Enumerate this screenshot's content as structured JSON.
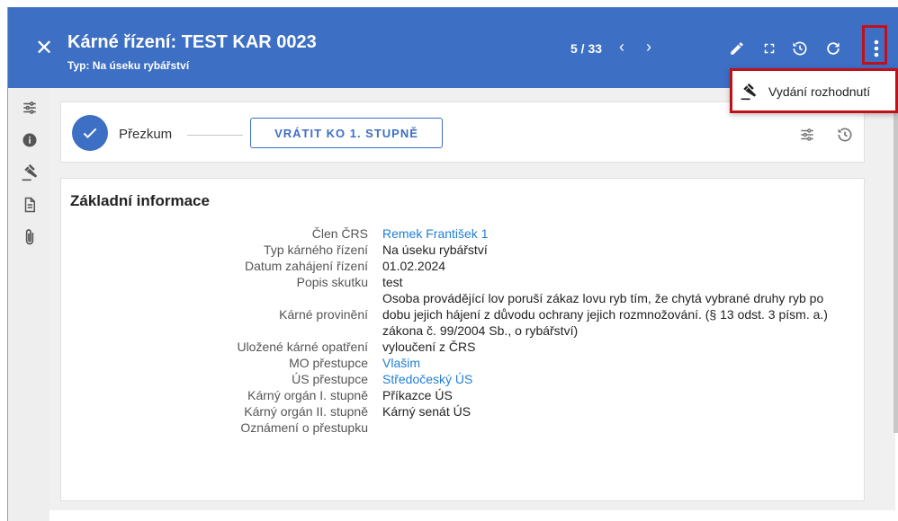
{
  "header": {
    "title": "Kárné řízení: TEST KAR 0023",
    "subtitle": "Typ: Na úseku rybářství",
    "pager": "5 / 33",
    "bg_color": "#3d6fc4",
    "icons": [
      "close-icon",
      "chevron-left-icon",
      "chevron-right-icon",
      "pencil-icon",
      "fullscreen-icon",
      "history-icon",
      "refresh-icon",
      "more-vert-icon"
    ]
  },
  "menu": {
    "items": [
      {
        "label": "Vydání rozhodnutí",
        "icon": "gavel-icon"
      }
    ],
    "highlight_color": "#c0111b"
  },
  "sidebar": {
    "icons": [
      "workflow-icon",
      "info-icon",
      "gavel-icon",
      "document-icon",
      "attachment-icon"
    ]
  },
  "workflow": {
    "step_label": "Přezkum",
    "return_button": "VRÁTIT KO 1. STUPNĚ"
  },
  "basic_info": {
    "title": "Základní informace",
    "rows": [
      {
        "label": "Člen ČRS",
        "value": "Remek František 1",
        "link": true
      },
      {
        "label": "Typ kárného řízení",
        "value": "Na úseku rybářství",
        "link": false
      },
      {
        "label": "Datum zahájení řízení",
        "value": "01.02.2024",
        "link": false
      },
      {
        "label": "Popis skutku",
        "value": "test",
        "link": false
      },
      {
        "label": "Kárné provinění",
        "value": "Osoba provádějící lov poruší zákaz lovu ryb tím, že chytá vybrané druhy ryb po dobu jejich hájení z důvodu ochrany jejich rozmnožování. (§ 13 odst. 3 písm. a.) zákona č. 99/2004 Sb., o rybářství)",
        "link": false
      },
      {
        "label": "Uložené kárné opatření",
        "value": "vyloučení z ČRS",
        "link": false
      },
      {
        "label": "MO přestupce",
        "value": "Vlašim",
        "link": true
      },
      {
        "label": "ÚS přestupce",
        "value": "Středočeský ÚS",
        "link": true
      },
      {
        "label": "Kárný orgán I. stupně",
        "value": "Příkazce ÚS",
        "link": false
      },
      {
        "label": "Kárný orgán II. stupně",
        "value": "Kárný senát ÚS",
        "link": false
      },
      {
        "label": "Oznámení o přestupku",
        "value": "",
        "link": false
      }
    ]
  }
}
